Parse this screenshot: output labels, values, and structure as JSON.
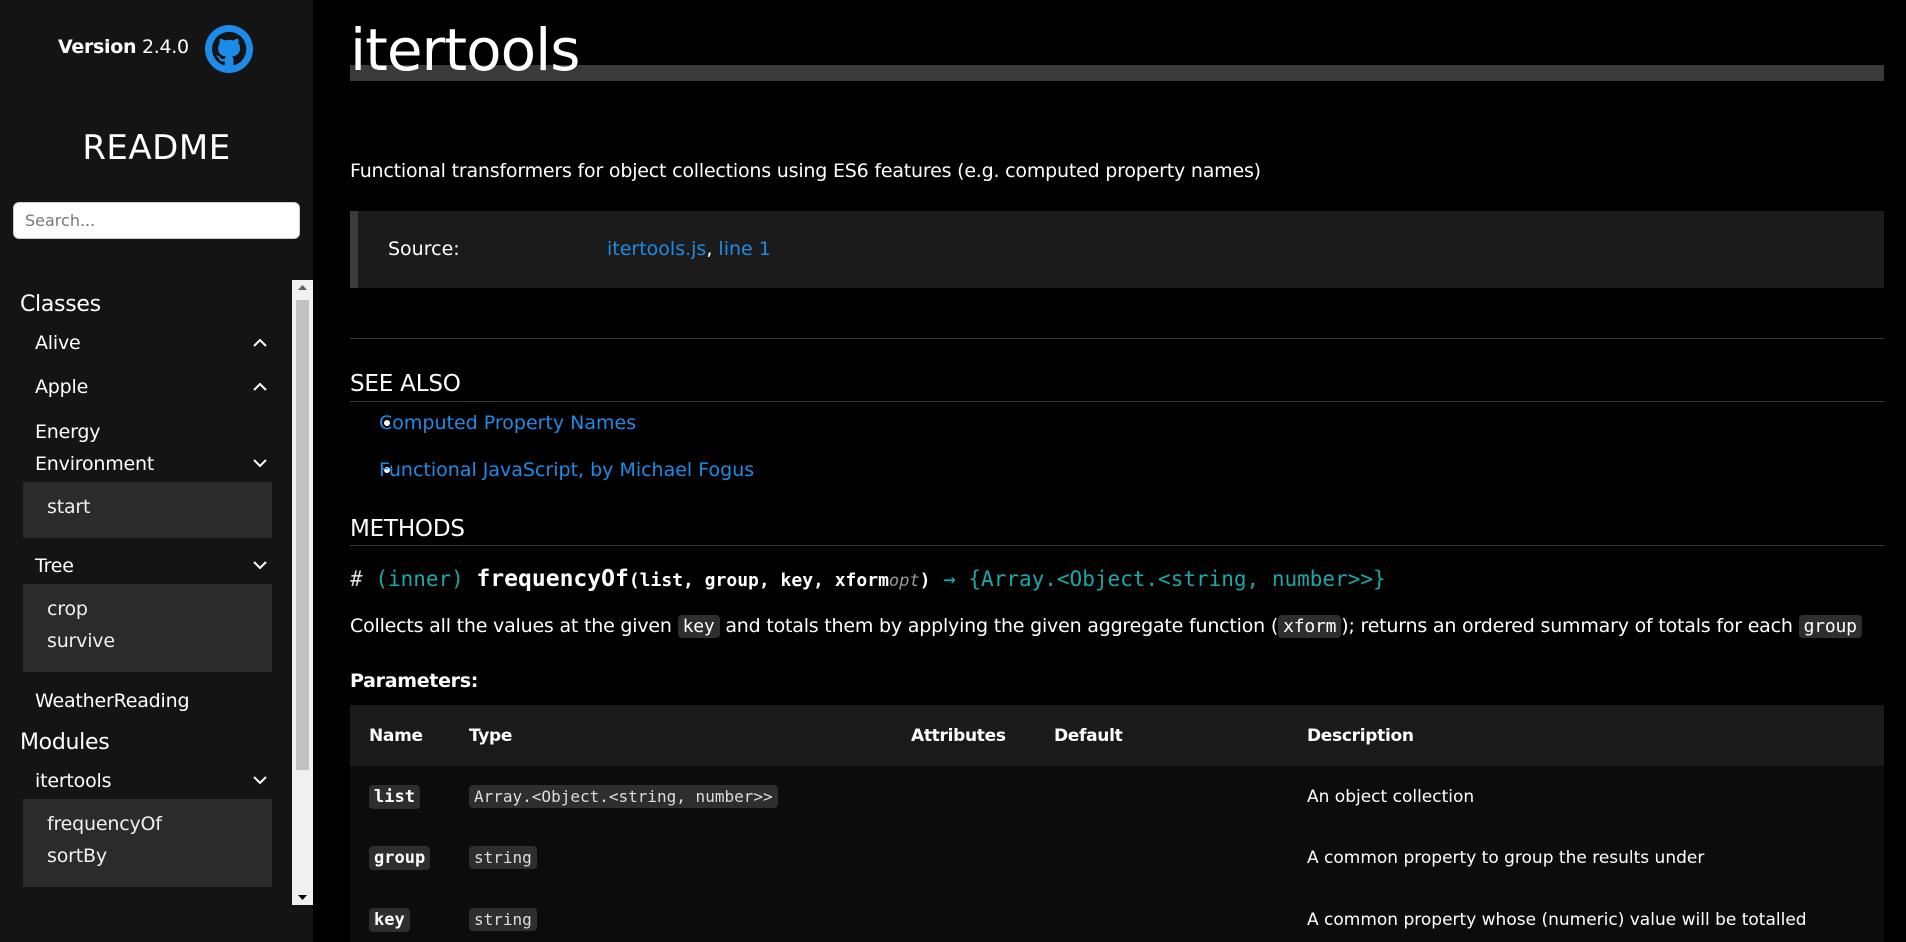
{
  "sidebar": {
    "version_label": "Version",
    "version_number": "2.4.0",
    "github_icon": "github-icon",
    "readme_title": "README",
    "search_placeholder": "Search...",
    "classes_heading": "Classes",
    "classes": {
      "alive": "Alive",
      "apple": "Apple",
      "energy": "Energy",
      "environment": "Environment",
      "environment_children": [
        "start"
      ],
      "tree": "Tree",
      "tree_children": [
        "crop",
        "survive"
      ],
      "weather_reading": "WeatherReading"
    },
    "modules_heading": "Modules",
    "modules": {
      "itertools": "itertools",
      "itertools_children": [
        "frequencyOf",
        "sortBy"
      ]
    }
  },
  "main": {
    "title": "itertools",
    "description": "Functional transformers for object collections using ES6 features (e.g. computed property names)",
    "source": {
      "label": "Source:",
      "file_link": "itertools.js",
      "separator": ",",
      "line_link": "line 1"
    },
    "see_also": {
      "heading": "SEE ALSO",
      "links": [
        "Computed Property Names",
        "Functional JavaScript, by Michael Fogus"
      ]
    },
    "methods": {
      "heading": "METHODS",
      "signature": {
        "hash": "#",
        "scope": "(inner)",
        "name": "frequencyOf",
        "open_paren": "(",
        "params": "list, group, key, xform",
        "opt": "opt",
        "close_paren": ")",
        "return_type": "→ {Array.<Object.<string, number>>}"
      },
      "description": {
        "part1": "Collects all the values at the given ",
        "code1": "key",
        "part2": " and totals them by applying the given aggregate function (",
        "code2": "xform",
        "part3": "); returns an ordered summary of totals for each ",
        "code3": "group"
      },
      "parameters_heading": "Parameters:",
      "table": {
        "headers": [
          "Name",
          "Type",
          "Attributes",
          "Default",
          "Description"
        ],
        "rows": [
          {
            "name": "list",
            "type": "Array.<Object.<string, number>>",
            "attributes": "",
            "default": "",
            "description": "An object collection"
          },
          {
            "name": "group",
            "type": "string",
            "attributes": "",
            "default": "",
            "description": "A common property to group the results under"
          },
          {
            "name": "key",
            "type": "string",
            "attributes": "",
            "default": "",
            "description": "A common property whose (numeric) value will be totalled"
          }
        ]
      }
    }
  },
  "colors": {
    "link": "#1d8ce8",
    "teal": "#1aa8a8",
    "sidebar_bg": "#141414",
    "main_bg": "#000000"
  }
}
